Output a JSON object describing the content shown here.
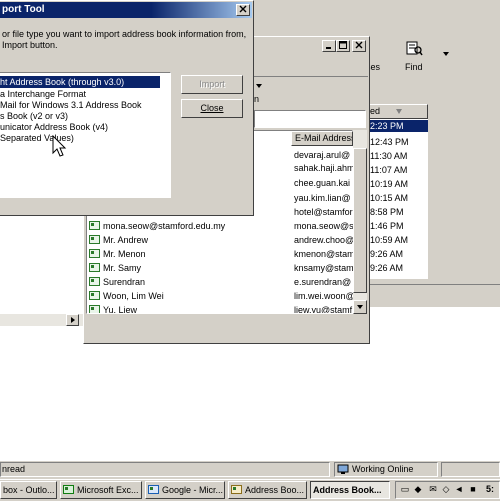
{
  "import_dialog": {
    "title": "port Tool",
    "close_glyph": "X",
    "instructions_line1": "or file type you want to import address book information from,",
    "instructions_line2": "Import button.",
    "formats": [
      "ht Address Book (through v3.0)",
      "a Interchange Format",
      "Mail for Windows 3.1 Address Book",
      "s Book (v2 or v3)",
      "unicator Address Book (v4)",
      "Separated Values)"
    ],
    "selected_index": 0,
    "import_label": "Import",
    "close_label": "Close"
  },
  "toolbar": {
    "ses_label": "ses",
    "find_label": "Find",
    "dropdown_glyph": "▾"
  },
  "received_header": "ed",
  "received_times": [
    "2:23 PM",
    "12:43 PM",
    "11:30 AM",
    "11:07 AM",
    "10:19 AM",
    "10:15 AM",
    "8:58 PM",
    "1:46 PM",
    "10:59 AM",
    "9:26 AM",
    "9:26 AM"
  ],
  "fragment_label": "n",
  "address_book": {
    "email_header": "E-Mail Address",
    "contacts": [
      {
        "name": "",
        "email": "devaraj.arul@"
      },
      {
        "name": "",
        "email": "sahak.haji.ahm"
      },
      {
        "name": "",
        "email": "chee.guan.kai"
      },
      {
        "name": "",
        "email": "yau.kim.lian@"
      },
      {
        "name": "",
        "email": "hotel@stamfor"
      },
      {
        "name": "mona.seow@stamford.edu.my",
        "email": "mona.seow@s"
      },
      {
        "name": "Mr. Andrew",
        "email": "andrew.choo@"
      },
      {
        "name": "Mr. Menon",
        "email": "kmenon@stam"
      },
      {
        "name": "Mr. Samy",
        "email": "knsamy@stamf"
      },
      {
        "name": "Surendran",
        "email": "e.surendran@"
      },
      {
        "name": "Woon, Lim Wei",
        "email": "lim.wei.woon@"
      },
      {
        "name": "Yu, Liew",
        "email": "liew.yu@stamf"
      }
    ]
  },
  "status_bar": {
    "left_text": "nread",
    "working_text": "Working Online"
  },
  "taskbar": {
    "items": [
      {
        "label": "box - Outlo..."
      },
      {
        "label": "Microsoft Exc..."
      },
      {
        "label": "Google - Micr..."
      },
      {
        "label": "Address Boo..."
      },
      {
        "label": "Address Book..."
      }
    ],
    "clock": "5:"
  }
}
